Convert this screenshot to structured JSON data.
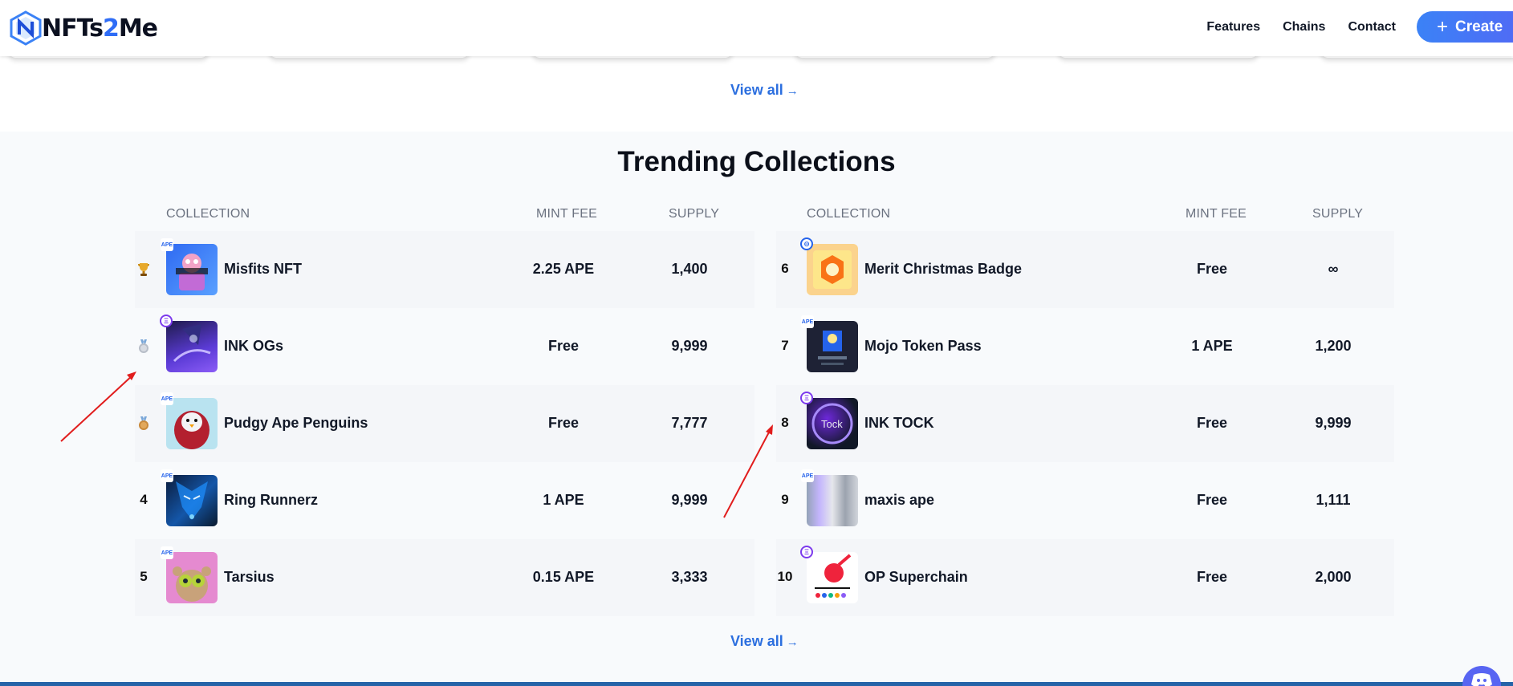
{
  "brand": {
    "name_part1": "NFTs",
    "name_part2": "2",
    "name_part3": "Me"
  },
  "nav": {
    "features": "Features",
    "chains": "Chains",
    "contact": "Contact",
    "create": "Create",
    "create_icon": "plus-icon"
  },
  "top_section": {
    "view_all": "View all"
  },
  "trending": {
    "title": "Trending Collections",
    "headers": {
      "collection": "COLLECTION",
      "mint_fee": "MINT FEE",
      "supply": "SUPPLY"
    },
    "left": [
      {
        "rank": "",
        "medal": "gold-trophy",
        "badge": "APE",
        "name": "Misfits NFT",
        "mint_fee": "2.25 APE",
        "supply": "1,400"
      },
      {
        "rank": "",
        "medal": "silver-medal",
        "badge": "ETH",
        "name": "INK OGs",
        "mint_fee": "Free",
        "supply": "9,999"
      },
      {
        "rank": "",
        "medal": "bronze-medal",
        "badge": "APE",
        "name": "Pudgy Ape Penguins",
        "mint_fee": "Free",
        "supply": "7,777"
      },
      {
        "rank": "4",
        "badge": "APE",
        "name": "Ring Runnerz",
        "mint_fee": "1 APE",
        "supply": "9,999"
      },
      {
        "rank": "5",
        "badge": "APE",
        "name": "Tarsius",
        "mint_fee": "0.15 APE",
        "supply": "3,333"
      }
    ],
    "right": [
      {
        "rank": "6",
        "badge": "GLOBE",
        "name": "Merit Christmas Badge",
        "mint_fee": "Free",
        "supply": "∞"
      },
      {
        "rank": "7",
        "badge": "APE",
        "name": "Mojo Token Pass",
        "mint_fee": "1 APE",
        "supply": "1,200"
      },
      {
        "rank": "8",
        "badge": "ETH",
        "name": "INK TOCK",
        "mint_fee": "Free",
        "supply": "9,999"
      },
      {
        "rank": "9",
        "badge": "APE",
        "name": "maxis ape",
        "mint_fee": "Free",
        "supply": "1,111"
      },
      {
        "rank": "10",
        "badge": "ETH",
        "name": "OP Superchain",
        "mint_fee": "Free",
        "supply": "2,000"
      }
    ],
    "view_all": "View all"
  },
  "colors": {
    "accent": "#2c6fdf",
    "create_btn": "#3b82f6",
    "row_bg": "#f4f6f9",
    "section_bg": "#f8fafc",
    "annotation": "#e11d1d"
  }
}
